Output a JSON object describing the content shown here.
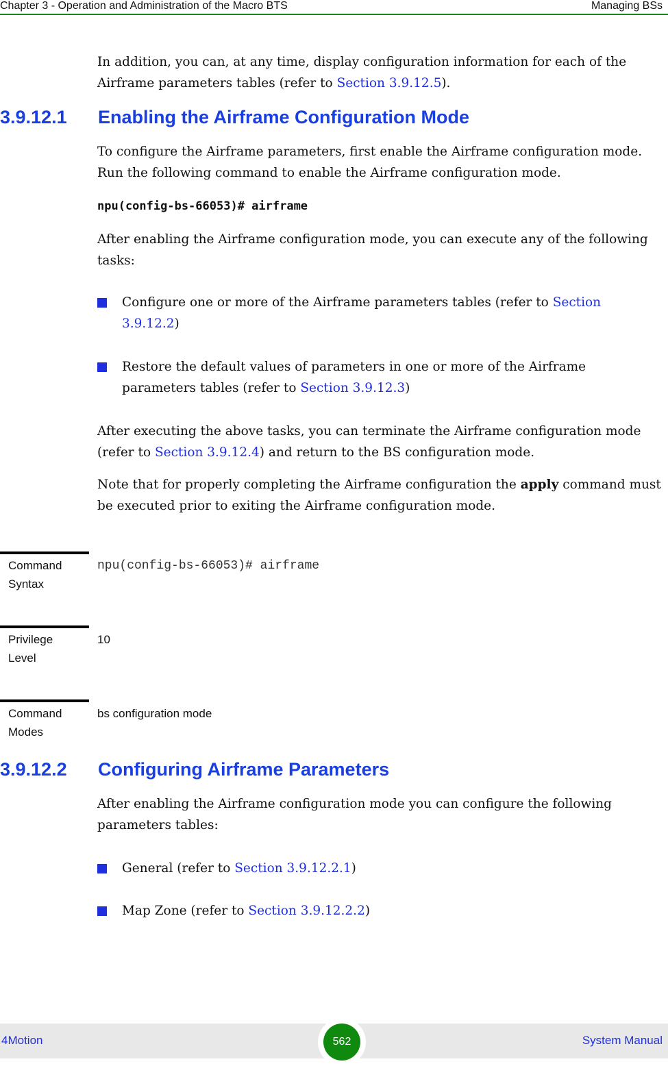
{
  "header": {
    "chapter": "Chapter 3 - Operation and Administration of the Macro BTS",
    "section": "Managing BSs"
  },
  "intro": {
    "text_before": "In addition, you can, at any time, display configuration information for each of the Airframe parameters tables (refer to ",
    "link": "Section 3.9.12.5",
    "text_after": ")."
  },
  "section1": {
    "number": "3.9.12.1",
    "title": "Enabling the Airframe Configuration Mode",
    "para1": "To configure the Airframe parameters, first enable the Airframe configuration mode. Run the following command to enable the Airframe configuration mode.",
    "command": "npu(config-bs-66053)# airframe",
    "para2": "After enabling the Airframe configuration mode, you can execute any of the following tasks:",
    "bullets": [
      {
        "text": "Configure one or more of the Airframe parameters tables (refer to ",
        "link": "Section 3.9.12.2",
        "after": ")"
      },
      {
        "text": "Restore the default values of parameters in one or more of the Airframe parameters tables (refer to ",
        "link": "Section 3.9.12.3",
        "after": ")"
      }
    ],
    "para3_before": "After executing the above tasks, you can terminate the Airframe configuration mode (refer to ",
    "para3_link": "Section 3.9.12.4",
    "para3_after": ") and return to the BS configuration mode.",
    "para4_before": "Note that for properly completing the Airframe configuration the ",
    "para4_bold": "apply",
    "para4_after": " command must be executed prior to exiting the Airframe configuration mode."
  },
  "command_table": [
    {
      "label1": "Command",
      "label2": "Syntax",
      "value": "npu(config-bs-66053)# airframe"
    },
    {
      "label1": "Privilege",
      "label2": "Level",
      "value": "10"
    },
    {
      "label1": "Command",
      "label2": "Modes",
      "value": "bs configuration mode"
    }
  ],
  "section2": {
    "number": "3.9.12.2",
    "title": "Configuring Airframe Parameters",
    "para1": "After enabling the Airframe configuration mode you can configure the following parameters tables:",
    "bullets": [
      {
        "text": "General (refer to ",
        "link": "Section 3.9.12.2.1",
        "after": ")"
      },
      {
        "text": "Map Zone (refer to ",
        "link": "Section 3.9.12.2.2",
        "after": ")"
      }
    ]
  },
  "footer": {
    "product": "4Motion",
    "page": "562",
    "manual": "System Manual"
  }
}
